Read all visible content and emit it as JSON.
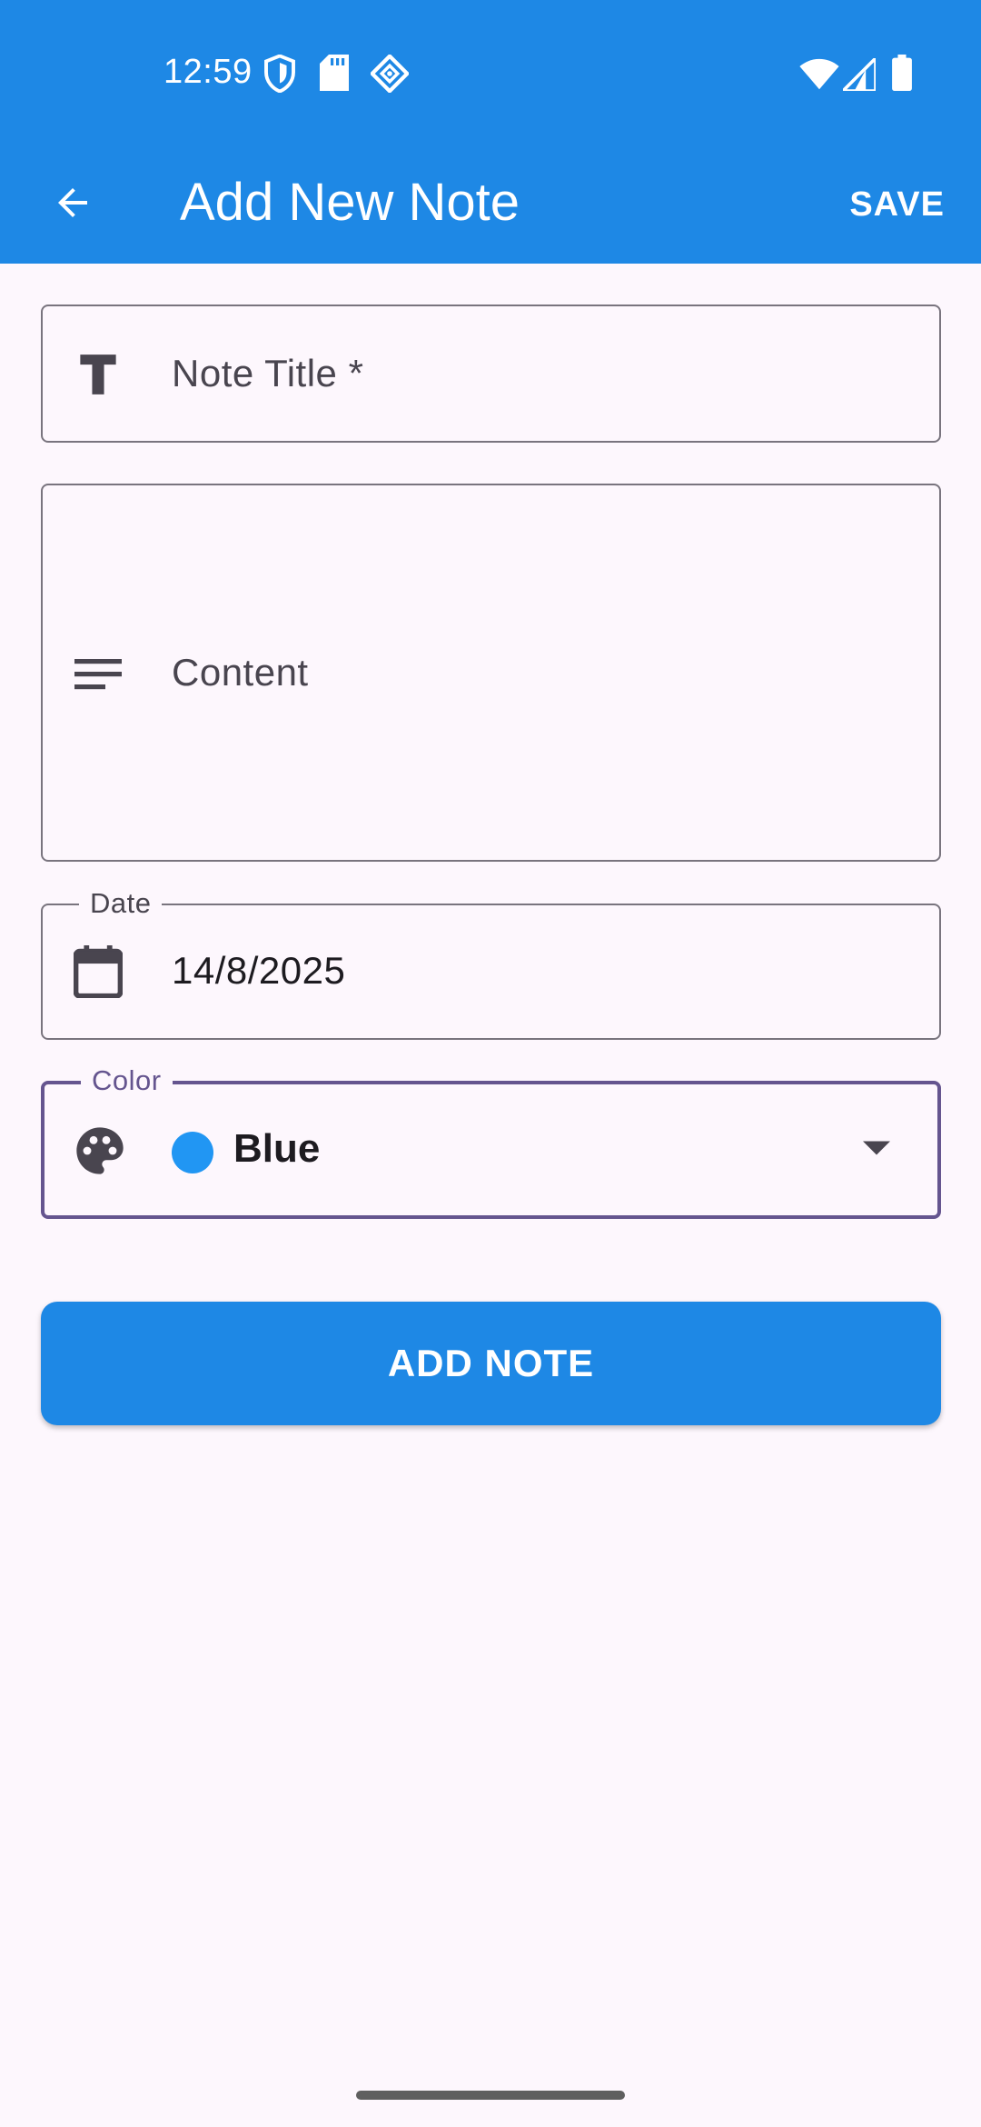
{
  "status_bar": {
    "time": "12:59",
    "left_icons": [
      "shield-icon",
      "sd-card-icon",
      "diamond-icon"
    ],
    "right_icons": [
      "wifi-icon",
      "signal-icon",
      "battery-icon"
    ]
  },
  "app_bar": {
    "title": "Add New Note",
    "save_label": "SAVE",
    "background": "#1e88e5"
  },
  "form": {
    "title": {
      "placeholder": "Note Title *",
      "icon": "text-title-icon"
    },
    "content": {
      "placeholder": "Content",
      "icon": "notes-lines-icon"
    },
    "date": {
      "label": "Date",
      "value": "14/8/2025",
      "icon": "calendar-icon"
    },
    "color": {
      "label": "Color",
      "value": "Blue",
      "swatch": "#2196f3",
      "icon": "palette-icon",
      "focused": true
    }
  },
  "add_button": {
    "label": "ADD NOTE"
  },
  "colors": {
    "primary": "#1e88e5",
    "focus_outline": "#65558f",
    "background": "#fdf7fd"
  }
}
